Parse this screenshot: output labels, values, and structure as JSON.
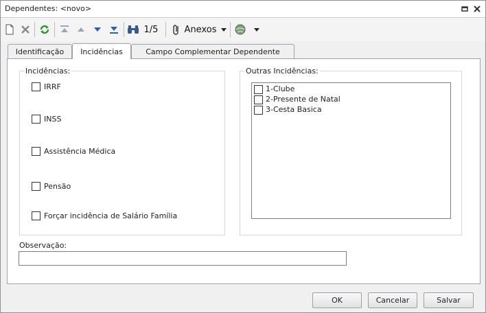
{
  "window": {
    "title": "Dependentes: <novo>"
  },
  "toolbar": {
    "record_counter": "1/5",
    "anexos_label": "Anexos",
    "icons": [
      "new-document-icon",
      "delete-x-icon",
      "refresh-icon",
      "first-record-icon",
      "previous-record-icon",
      "next-record-icon",
      "last-record-icon",
      "binoculars-icon",
      "paperclip-icon",
      "dropdown-arrow-icon",
      "globe-icon",
      "dropdown-arrow-icon"
    ]
  },
  "tabs": [
    {
      "label": "Identificação",
      "active": false
    },
    {
      "label": "Incidências",
      "active": true
    },
    {
      "label": "Campo Complementar Dependente",
      "active": false
    }
  ],
  "incidencias": {
    "label": "Incidências:",
    "items": [
      "IRRF",
      "INSS",
      "Assistência Médica",
      "Pensão",
      "Forçar incidência de Salário Família"
    ]
  },
  "outras": {
    "label": "Outras Incidências:",
    "items": [
      "1-Clube",
      "2-Presente de Natal",
      "3-Cesta Basica"
    ]
  },
  "observacao": {
    "label": "Observação:",
    "value": ""
  },
  "buttons": {
    "ok": "OK",
    "cancel": "Cancelar",
    "save": "Salvar"
  },
  "colors": {
    "accent_green": "#2e9a2e",
    "accent_blue": "#2a5fb8"
  }
}
